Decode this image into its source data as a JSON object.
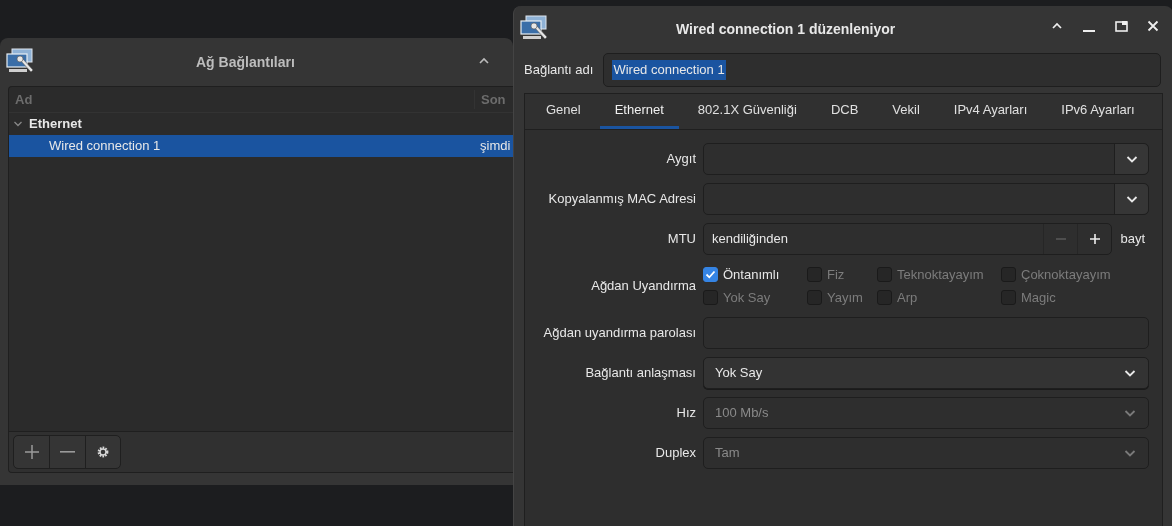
{
  "connections_window": {
    "title": "Ağ Bağlantıları",
    "columns": [
      "Ad",
      "Son"
    ],
    "groups": [
      {
        "label": "Ethernet",
        "expanded": true,
        "children": [
          {
            "name": "Wired connection 1",
            "last_used": "şimdi",
            "selected": true
          }
        ]
      }
    ]
  },
  "editor_window": {
    "title": "Wired connection 1 düzenleniyor",
    "name_label": "Bağlantı adı",
    "name_value": "Wired connection 1",
    "tabs": [
      {
        "label": "Genel",
        "selected": false
      },
      {
        "label": "Ethernet",
        "selected": true
      },
      {
        "label": "802.1X Güvenliği",
        "selected": false
      },
      {
        "label": "DCB",
        "selected": false
      },
      {
        "label": "Vekil",
        "selected": false
      },
      {
        "label": "IPv4 Ayarları",
        "selected": false
      },
      {
        "label": "IPv6 Ayarları",
        "selected": false
      }
    ],
    "fields": [
      {
        "kind": "combo",
        "label": "Aygıt"
      },
      {
        "kind": "combo",
        "label": "Kopyalanmış MAC Adresi"
      },
      {
        "kind": "spin",
        "label": "MTU",
        "value": "kendiliğinden",
        "unit": "bayt"
      },
      {
        "kind": "checks",
        "label": "Ağdan Uyandırma",
        "options": [
          {
            "label": "Öntanımlı",
            "checked": true,
            "disabled": false
          },
          {
            "label": "Fiz",
            "checked": false,
            "disabled": true
          },
          {
            "label": "Teknoktayayım",
            "checked": false,
            "disabled": true
          },
          {
            "label": "Çoknoktayayım",
            "checked": false,
            "disabled": true
          },
          {
            "label": "Yok Say",
            "checked": false,
            "disabled": true
          },
          {
            "label": "Yayım",
            "checked": false,
            "disabled": true
          },
          {
            "label": "Arp",
            "checked": false,
            "disabled": true
          },
          {
            "label": "Magic",
            "checked": false,
            "disabled": true
          }
        ]
      },
      {
        "kind": "text",
        "label": "Ağdan uyandırma parolası"
      },
      {
        "kind": "select",
        "label": "Bağlantı anlaşması",
        "value": "Yok Say",
        "disabled": false
      },
      {
        "kind": "select",
        "label": "Hız",
        "value": "100 Mb/s",
        "disabled": true
      },
      {
        "kind": "select",
        "label": "Duplex",
        "value": "Tam",
        "disabled": true
      }
    ]
  }
}
